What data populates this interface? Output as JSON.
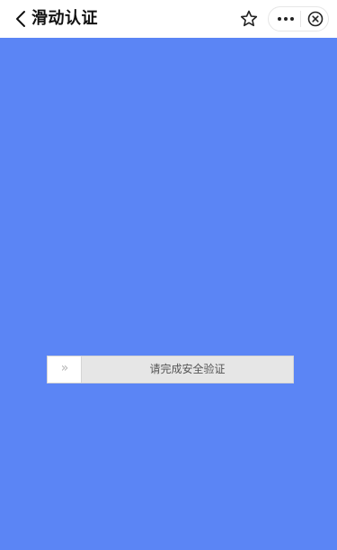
{
  "header": {
    "title": "滑动认证"
  },
  "icons": {
    "back": "chevron-left-icon",
    "favorite": "star-outline-icon",
    "more": "more-dots-icon",
    "close": "close-circle-icon"
  },
  "slider": {
    "label": "请完成安全验证",
    "handle_glyph": "»",
    "progress": 0
  },
  "colors": {
    "page_background": "#5b85f5",
    "header_background": "#ffffff",
    "slider_track": "#e6e6e6",
    "slider_handle": "#ffffff"
  }
}
